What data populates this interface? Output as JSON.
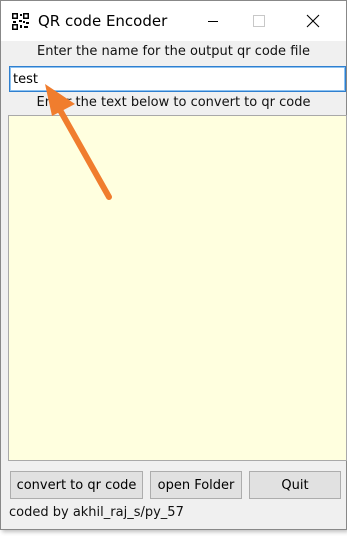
{
  "window": {
    "title": "QR code Encoder",
    "icon": "qr-code-icon",
    "controls": {
      "minimize_icon": "minimize-icon",
      "maximize_icon": "maximize-icon",
      "close_icon": "close-icon"
    }
  },
  "form": {
    "filename_label": "Enter the name for the output qr code file",
    "filename_value": "test",
    "text_label": "Enter the text below to convert to qr code",
    "text_value": ""
  },
  "buttons": {
    "convert": "convert to qr code",
    "open_folder": "open Folder",
    "quit": "Quit"
  },
  "footer": {
    "credit": "coded by akhil_raj_s/py_57"
  },
  "colors": {
    "window_bg": "#f0f0f0",
    "textarea_bg": "#ffffdf",
    "input_focus_border": "#2f7fcf",
    "annotation_arrow": "#f07d2e"
  }
}
